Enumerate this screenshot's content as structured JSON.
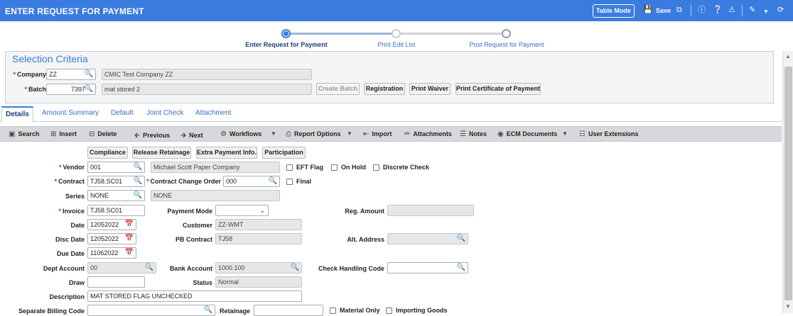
{
  "header": {
    "title": "ENTER REQUEST FOR PAYMENT",
    "table_mode": "Table Mode",
    "save": "Save"
  },
  "steps": [
    {
      "label": "Enter Request for Payment"
    },
    {
      "label": "Print Edit List"
    },
    {
      "label": "Post Request for Payment"
    }
  ],
  "selection": {
    "title": "Selection Criteria",
    "company_label": "Company",
    "company_value": "ZZ",
    "company_name": "CMIC Test Company ZZ",
    "batch_label": "Batch",
    "batch_value": "7397",
    "batch_desc": "mat stored 2",
    "create_batch": "Create Batch",
    "registration": "Registration",
    "print_waiver": "Print Waiver",
    "print_cert": "Print Certificate of Payment"
  },
  "tabs": [
    "Details",
    "Amount Summary",
    "Default",
    "Joint Check",
    "Attachment"
  ],
  "toolbar": {
    "search": "Search",
    "insert": "Insert",
    "delete": "Delete",
    "previous": "Previous",
    "next": "Next",
    "workflows": "Workflows",
    "report_options": "Report Options",
    "import": "Import",
    "attachments": "Attachments",
    "notes": "Notes",
    "ecm_documents": "ECM Documents",
    "user_extensions": "User Extensions"
  },
  "buttons": {
    "compliance": "Compliance",
    "release_retainage": "Release Retainage",
    "extra_payment": "Extra Payment Info.",
    "participation": "Participation"
  },
  "form": {
    "vendor_label": "Vendor",
    "vendor_value": "001",
    "vendor_name": "Michael Scott Paper Company",
    "eft_flag": "EFT Flag",
    "on_hold": "On Hold",
    "discrete_check": "Discrete Check",
    "contract_label": "Contract",
    "contract_value": "TJ58.SC01",
    "cco_label": "Contract Change Order",
    "cco_value": "000",
    "final": "Final",
    "series_label": "Series",
    "series_value": "NONE",
    "series_desc": "NONE",
    "invoice_label": "Invoice",
    "invoice_value": "TJ58.SC01",
    "payment_mode_label": "Payment Mode",
    "payment_mode_value": "",
    "reg_amount_label": "Reg. Amount",
    "reg_amount_value": "",
    "date_label": "Date",
    "date_value": "12052022",
    "customer_label": "Customer",
    "customer_value": "ZZ-WMT",
    "disc_date_label": "Disc Date",
    "disc_date_value": "12052022",
    "pb_contract_label": "PB Contract",
    "pb_contract_value": "TJ58",
    "alt_address_label": "Alt. Address",
    "alt_address_value": "",
    "due_date_label": "Due Date",
    "due_date_value": "11062022",
    "dept_account_label": "Dept Account",
    "dept_account_value": "00",
    "bank_account_label": "Bank Account",
    "bank_account_value": "1000.100",
    "check_handling_label": "Check Handling Code",
    "check_handling_value": "",
    "draw_label": "Draw",
    "draw_value": "",
    "status_label": "Status",
    "status_value": "Normal",
    "description_label": "Description",
    "description_value": "MAT STORED FLAG UNCHECKED",
    "sep_billing_label": "Separate Billing Code",
    "sep_billing_value": "",
    "retainage_label": "Retainage",
    "retainage_value": "",
    "material_only": "Material Only",
    "importing_goods": "Importing Goods"
  },
  "colors": {
    "accent": "#3a7be0",
    "required": "#d22222"
  }
}
